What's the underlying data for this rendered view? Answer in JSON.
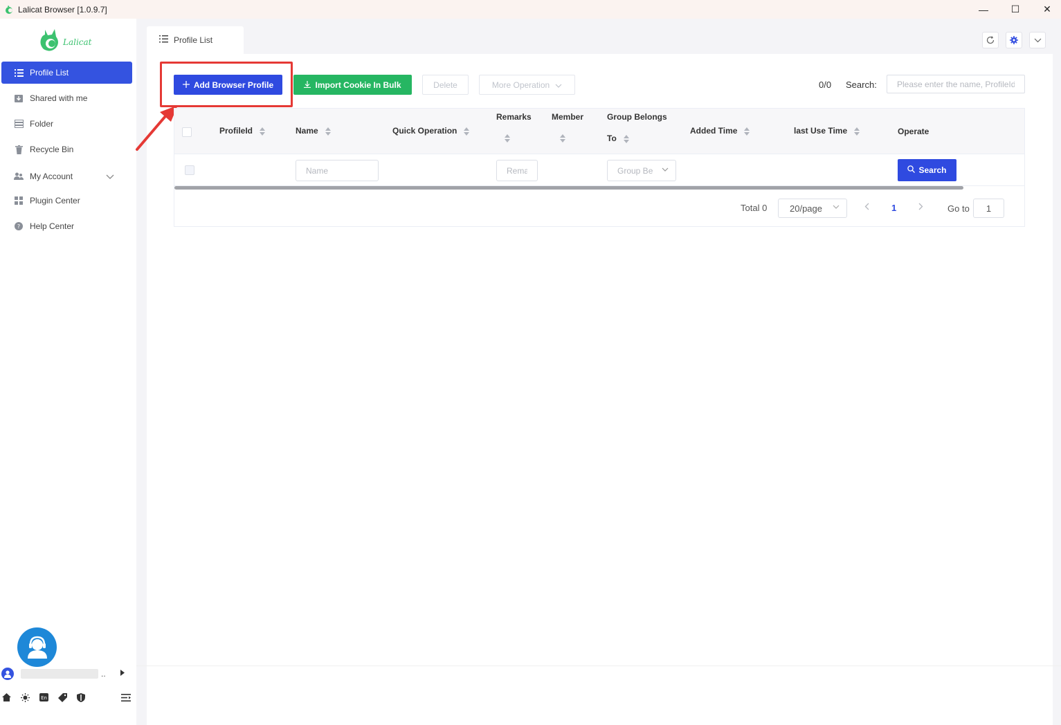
{
  "window": {
    "title": "Lalicat Browser  [1.0.9.7]",
    "controls": {
      "minimize": "—",
      "maximize": "☐",
      "close": "✕"
    }
  },
  "sidebar": {
    "logo_text": "Lalicat",
    "items": [
      {
        "label": "Profile List",
        "icon": "list-icon"
      },
      {
        "label": "Shared with me",
        "icon": "download-box-icon"
      },
      {
        "label": "Folder",
        "icon": "folder-icon"
      },
      {
        "label": "Recycle Bin",
        "icon": "trash-icon"
      },
      {
        "label": "My Account",
        "icon": "users-icon"
      },
      {
        "label": "Plugin Center",
        "icon": "grid-icon"
      },
      {
        "label": "Help Center",
        "icon": "help-icon"
      }
    ],
    "user_suffix": ".."
  },
  "tab": {
    "label": "Profile List"
  },
  "toolbar": {
    "add_profile": "Add Browser Profile",
    "import_cookie": "Import Cookie In Bulk",
    "delete": "Delete",
    "more_operation": "More Operation",
    "counter": "0/0",
    "search_label": "Search:",
    "search_placeholder": "Please enter the name, ProfileId"
  },
  "table": {
    "columns": {
      "profile_id": "ProfileId",
      "name": "Name",
      "quick_operation": "Quick Operation",
      "remarks": "Remarks",
      "member": "Member",
      "group_line1": "Group Belongs",
      "group_line2": "To",
      "added_time": "Added Time",
      "last_use_time": "last Use Time",
      "operate": "Operate"
    },
    "filters": {
      "name_placeholder": "Name",
      "remarks_placeholder": "Remarks",
      "group_placeholder": "Group Be",
      "search_button": "Search"
    }
  },
  "pagination": {
    "total": "Total 0",
    "page_size": "20/page",
    "current_page": "1",
    "goto_label": "Go to",
    "goto_value": "1"
  },
  "colors": {
    "primary": "#2f4ae0",
    "success": "#26b662",
    "highlight": "#e53935"
  }
}
